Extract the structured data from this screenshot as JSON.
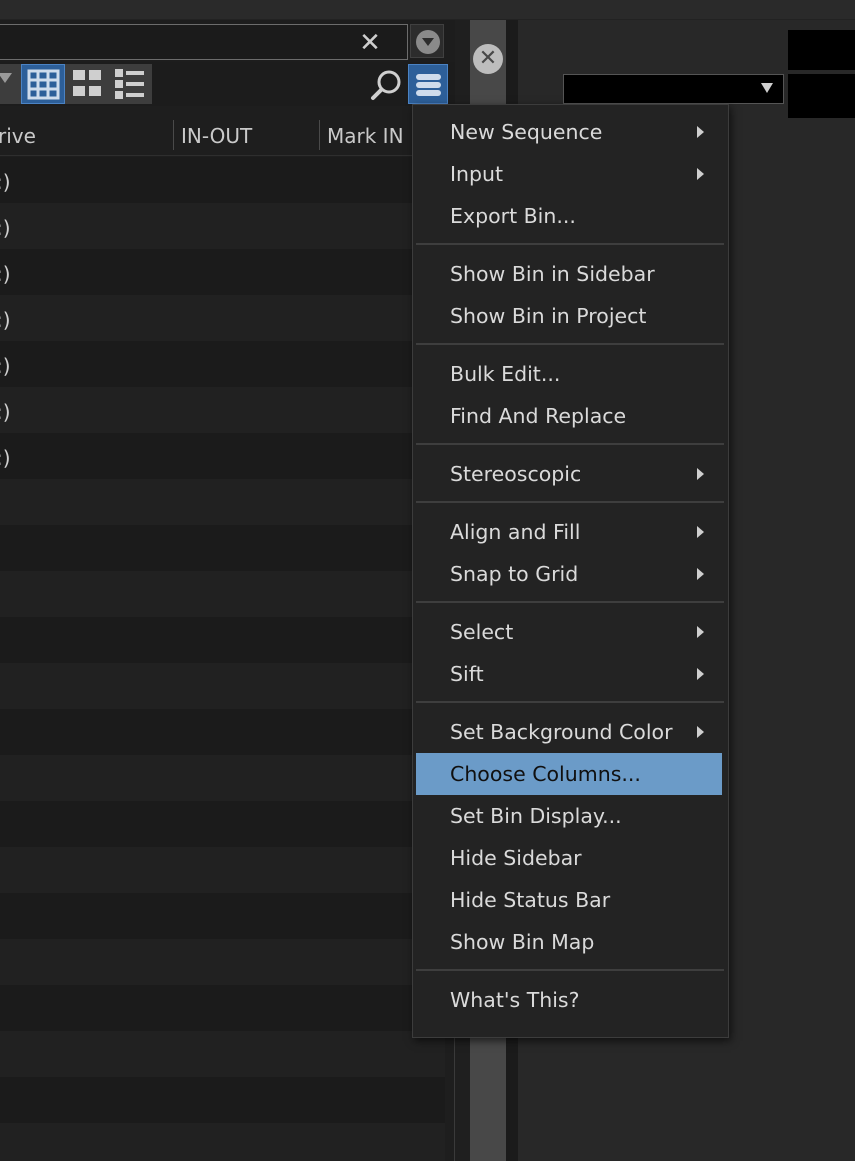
{
  "bin": {
    "close_symbol": "✕",
    "columns": [
      "rive",
      "IN-OUT",
      "Mark IN"
    ],
    "row_fragment": ":)",
    "rows_with_text": 7,
    "total_rows": 22
  },
  "colors": {
    "accent": "#2d5f99",
    "menu_selected": "#6b9bc8",
    "menu_bg": "#232323"
  },
  "menu": {
    "groups": [
      [
        {
          "label": "New Sequence",
          "submenu": true
        },
        {
          "label": "Input",
          "submenu": true
        },
        {
          "label": "Export Bin...",
          "submenu": false
        }
      ],
      [
        {
          "label": "Show Bin in Sidebar",
          "submenu": false
        },
        {
          "label": "Show Bin in Project",
          "submenu": false
        }
      ],
      [
        {
          "label": "Bulk Edit...",
          "submenu": false
        },
        {
          "label": "Find And Replace",
          "submenu": false
        }
      ],
      [
        {
          "label": "Stereoscopic",
          "submenu": true
        }
      ],
      [
        {
          "label": "Align and Fill",
          "submenu": true
        },
        {
          "label": "Snap to Grid",
          "submenu": true
        }
      ],
      [
        {
          "label": "Select",
          "submenu": true
        },
        {
          "label": "Sift",
          "submenu": true
        }
      ],
      [
        {
          "label": "Set Background Color",
          "submenu": true
        },
        {
          "label": "Choose Columns...",
          "submenu": false,
          "selected": true
        },
        {
          "label": "Set Bin Display...",
          "submenu": false
        },
        {
          "label": "Hide Sidebar",
          "submenu": false
        },
        {
          "label": "Hide Status Bar",
          "submenu": false
        },
        {
          "label": "Show Bin Map",
          "submenu": false
        }
      ],
      [
        {
          "label": "What's This?",
          "submenu": false
        }
      ]
    ]
  },
  "icons": {
    "close": "close-icon",
    "dropdown": "dropdown-circle-icon",
    "frame_view": "frame-view-icon",
    "text_view": "text-view-icon",
    "script_view": "script-view-icon",
    "search": "search-icon",
    "fast_menu": "hamburger-menu-icon",
    "panel_close": "panel-close-icon"
  }
}
